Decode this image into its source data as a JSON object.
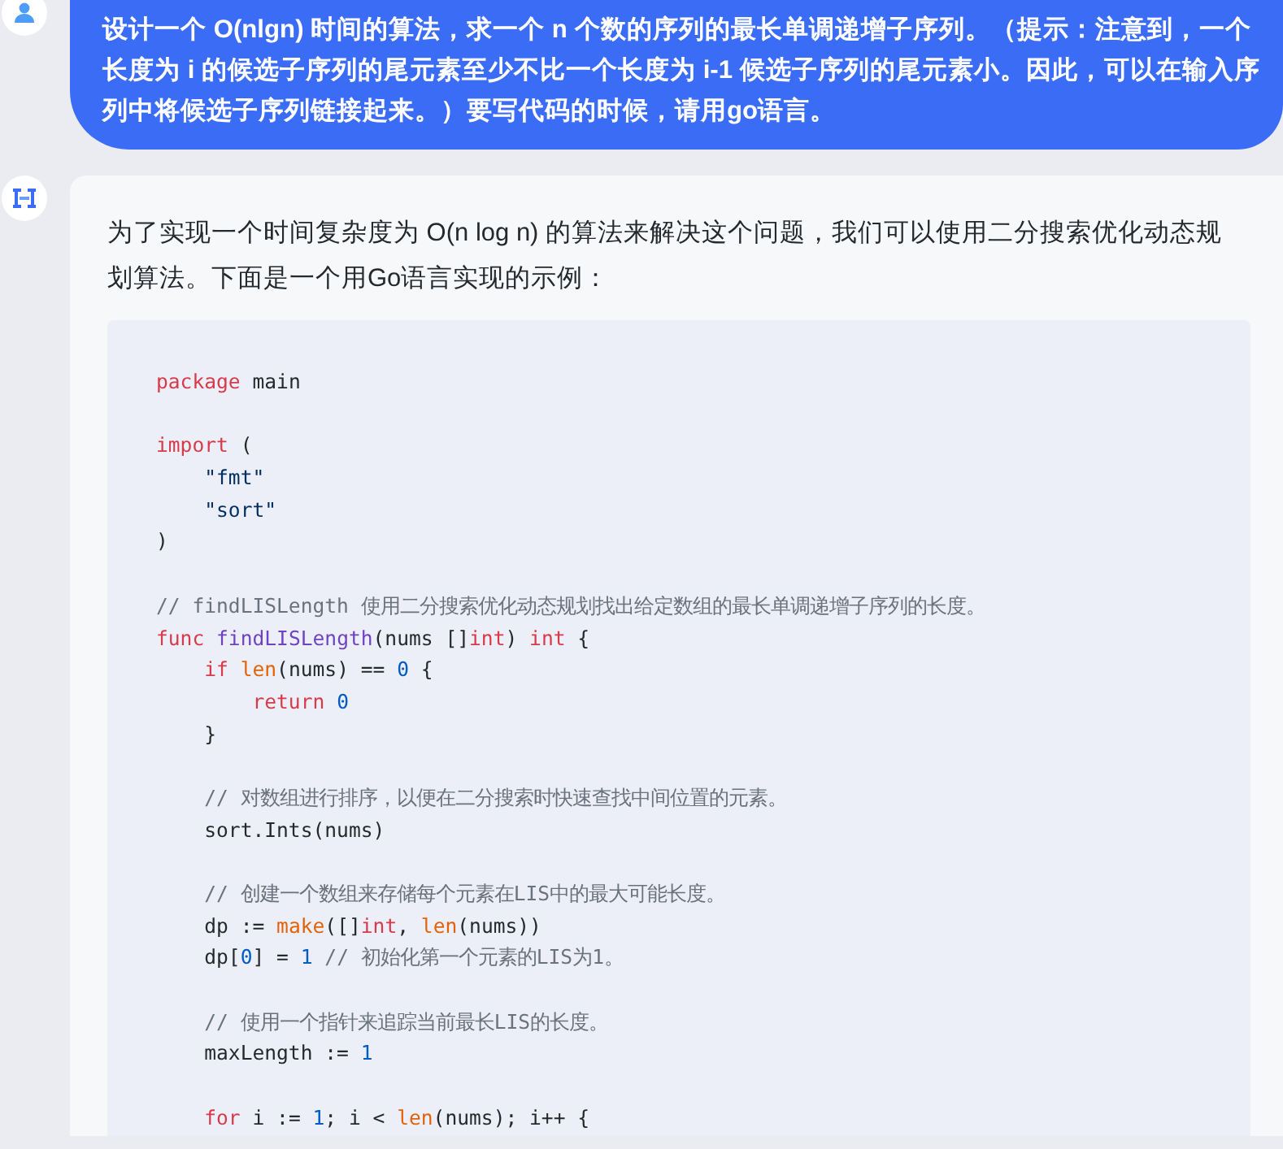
{
  "user_message": {
    "text": "设计一个 O(nlgn) 时间的算法，求一个 n 个数的序列的最长单调递增子序列。（提示：注意到，一个长度为 i 的候选子序列的尾元素至少不比一个长度为 i-1 候选子序列的尾元素小。因此，可以在输入序列中将候选子序列链接起来。）要写代码的时候，请用go语言。"
  },
  "reply": {
    "intro": "为了实现一个时间复杂度为 O(n log n) 的算法来解决这个问题，我们可以使用二分搜索优化动态规划算法。下面是一个用Go语言实现的示例：",
    "code": {
      "lines": [
        {
          "kind": "code",
          "tokens": [
            {
              "kind": "keyword",
              "t": "package"
            },
            {
              "kind": "plain",
              "t": " main"
            }
          ]
        },
        {
          "kind": "blank"
        },
        {
          "kind": "code",
          "tokens": [
            {
              "kind": "keyword",
              "t": "import"
            },
            {
              "kind": "plain",
              "t": " ("
            }
          ]
        },
        {
          "kind": "code",
          "tokens": [
            {
              "kind": "string",
              "t": "    \"fmt\""
            }
          ]
        },
        {
          "kind": "code",
          "tokens": [
            {
              "kind": "string",
              "t": "    \"sort\""
            }
          ]
        },
        {
          "kind": "code",
          "tokens": [
            {
              "kind": "plain",
              "t": ")"
            }
          ]
        },
        {
          "kind": "blank"
        },
        {
          "kind": "code",
          "tokens": [
            {
              "kind": "comment",
              "t": "// findLISLength 使用二分搜索优化动态规划找出给定数组的最长单调递增子序列的长度。"
            }
          ]
        },
        {
          "kind": "code",
          "tokens": [
            {
              "kind": "keyword",
              "t": "func "
            },
            {
              "kind": "function",
              "t": "findLISLength"
            },
            {
              "kind": "plain",
              "t": "(nums []"
            },
            {
              "kind": "keyword",
              "t": "int"
            },
            {
              "kind": "plain",
              "t": ") "
            },
            {
              "kind": "keyword",
              "t": "int"
            },
            {
              "kind": "plain",
              "t": " {"
            }
          ]
        },
        {
          "kind": "code",
          "tokens": [
            {
              "kind": "keyword",
              "t": "    if "
            },
            {
              "kind": "builtin",
              "t": "len"
            },
            {
              "kind": "plain",
              "t": "(nums) == "
            },
            {
              "kind": "number",
              "t": "0"
            },
            {
              "kind": "plain",
              "t": " {"
            }
          ]
        },
        {
          "kind": "code",
          "tokens": [
            {
              "kind": "keyword",
              "t": "        return "
            },
            {
              "kind": "number",
              "t": "0"
            }
          ]
        },
        {
          "kind": "code",
          "tokens": [
            {
              "kind": "plain",
              "t": "    }"
            }
          ]
        },
        {
          "kind": "blank"
        },
        {
          "kind": "code",
          "tokens": [
            {
              "kind": "comment",
              "t": "    // 对数组进行排序，以便在二分搜索时快速查找中间位置的元素。"
            }
          ]
        },
        {
          "kind": "code",
          "tokens": [
            {
              "kind": "plain",
              "t": "    sort.Ints(nums)"
            }
          ]
        },
        {
          "kind": "blank"
        },
        {
          "kind": "code",
          "tokens": [
            {
              "kind": "comment",
              "t": "    // 创建一个数组来存储每个元素在LIS中的最大可能长度。"
            }
          ]
        },
        {
          "kind": "code",
          "tokens": [
            {
              "kind": "plain",
              "t": "    dp := "
            },
            {
              "kind": "builtin",
              "t": "make"
            },
            {
              "kind": "plain",
              "t": "([]"
            },
            {
              "kind": "keyword",
              "t": "int"
            },
            {
              "kind": "plain",
              "t": ", "
            },
            {
              "kind": "builtin",
              "t": "len"
            },
            {
              "kind": "plain",
              "t": "(nums))"
            }
          ]
        },
        {
          "kind": "code",
          "tokens": [
            {
              "kind": "plain",
              "t": "    dp["
            },
            {
              "kind": "number",
              "t": "0"
            },
            {
              "kind": "plain",
              "t": "] = "
            },
            {
              "kind": "number",
              "t": "1"
            },
            {
              "kind": "comment",
              "t": " // 初始化第一个元素的LIS为1。"
            }
          ]
        },
        {
          "kind": "blank"
        },
        {
          "kind": "code",
          "tokens": [
            {
              "kind": "comment",
              "t": "    // 使用一个指针来追踪当前最长LIS的长度。"
            }
          ]
        },
        {
          "kind": "code",
          "tokens": [
            {
              "kind": "plain",
              "t": "    maxLength := "
            },
            {
              "kind": "number",
              "t": "1"
            }
          ]
        },
        {
          "kind": "blank"
        },
        {
          "kind": "code",
          "tokens": [
            {
              "kind": "keyword",
              "t": "    for"
            },
            {
              "kind": "plain",
              "t": " i := "
            },
            {
              "kind": "number",
              "t": "1"
            },
            {
              "kind": "plain",
              "t": "; i < "
            },
            {
              "kind": "builtin",
              "t": "len"
            },
            {
              "kind": "plain",
              "t": "(nums); i++ {"
            }
          ]
        }
      ]
    }
  }
}
